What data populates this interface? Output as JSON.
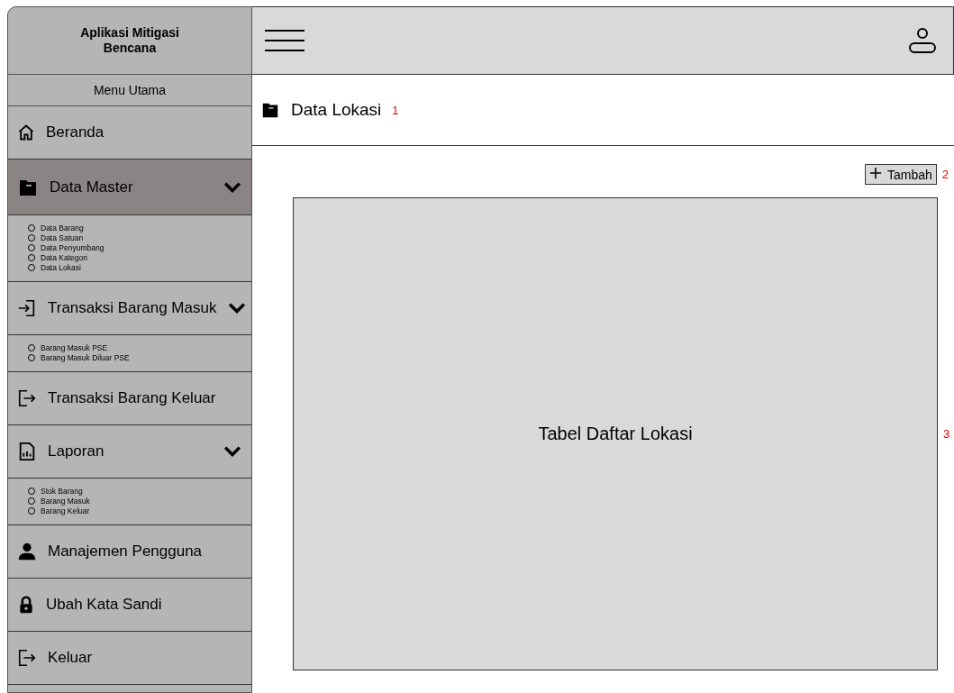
{
  "sidebar": {
    "app_title": "Aplikasi Mitigasi Bencana",
    "section_label": "Menu Utama",
    "items": [
      {
        "label": "Beranda",
        "selected": false
      },
      {
        "label": "Data Master",
        "selected": true,
        "expanded": true,
        "children": [
          "Data Barang",
          "Data Satuan",
          "Data Penyumbang",
          "Data Kategori",
          "Data Lokasi"
        ]
      },
      {
        "label": "Transaksi Barang Masuk",
        "selected": false,
        "expanded": true,
        "children": [
          "Barang Masuk PSE",
          "Barang Masuk Diluar PSE"
        ]
      },
      {
        "label": "Transaksi Barang Keluar",
        "selected": false
      },
      {
        "label": "Laporan",
        "selected": false,
        "expanded": true,
        "children": [
          "Stok Barang",
          "Barang Masuk",
          "Barang Keluar"
        ]
      },
      {
        "label": "Manajemen Pengguna",
        "selected": false
      },
      {
        "label": "Ubah Kata Sandi",
        "selected": false
      },
      {
        "label": "Keluar",
        "selected": false
      }
    ]
  },
  "page": {
    "title": "Data Lokasi",
    "title_note": "1",
    "add_button": "Tambah",
    "add_note": "2",
    "table_placeholder": "Tabel Daftar Lokasi",
    "table_note": "3"
  }
}
